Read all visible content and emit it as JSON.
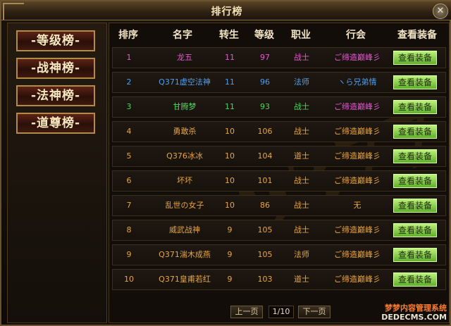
{
  "window": {
    "title": "排行榜",
    "close_glyph": "✕"
  },
  "tabs": [
    {
      "label": "-等级榜-",
      "active": true
    },
    {
      "label": "-战神榜-",
      "active": false
    },
    {
      "label": "-法神榜-",
      "active": false
    },
    {
      "label": "-道尊榜-",
      "active": false
    }
  ],
  "table": {
    "headers": [
      "排序",
      "名字",
      "转生",
      "等级",
      "职业",
      "行会",
      "查看装备"
    ],
    "rows": [
      {
        "rank": "1",
        "name": "龙五",
        "rebirth": "11",
        "level": "97",
        "class": "战士",
        "guild": "ご缔造巅峰彡",
        "button": "查看装备",
        "color": "#e25bd0",
        "guild_color": "#e25bd0"
      },
      {
        "rank": "2",
        "name": "Q371虚空法神",
        "rebirth": "11",
        "level": "96",
        "class": "法师",
        "guild": "ヽら兄弟情",
        "button": "查看装备",
        "color": "#4f9ef0",
        "guild_color": "#4f9ef0"
      },
      {
        "rank": "3",
        "name": "甘腾梦",
        "rebirth": "11",
        "level": "93",
        "class": "战士",
        "guild": "ご缔造巅峰彡",
        "button": "查看装备",
        "color": "#4fd65a",
        "guild_color": "#e25bd0"
      },
      {
        "rank": "4",
        "name": "勇敢杀",
        "rebirth": "10",
        "level": "106",
        "class": "战士",
        "guild": "ご缔造巅峰彡",
        "button": "查看装备",
        "color": "#e8a640",
        "guild_color": "#e8a640"
      },
      {
        "rank": "5",
        "name": "Q376冰冰",
        "rebirth": "10",
        "level": "104",
        "class": "道士",
        "guild": "ご缔造巅峰彡",
        "button": "查看装备",
        "color": "#e8a640",
        "guild_color": "#e8a640"
      },
      {
        "rank": "6",
        "name": "坏坏",
        "rebirth": "10",
        "level": "101",
        "class": "战士",
        "guild": "ご缔造巅峰彡",
        "button": "查看装备",
        "color": "#e8a640",
        "guild_color": "#e8a640"
      },
      {
        "rank": "7",
        "name": "乱世の女子",
        "rebirth": "10",
        "level": "86",
        "class": "战士",
        "guild": "无",
        "button": "查看装备",
        "color": "#e8a640",
        "guild_color": "#e8a640"
      },
      {
        "rank": "8",
        "name": "威武战神",
        "rebirth": "9",
        "level": "105",
        "class": "战士",
        "guild": "ご缔造巅峰彡",
        "button": "查看装备",
        "color": "#e8a640",
        "guild_color": "#e8a640"
      },
      {
        "rank": "9",
        "name": "Q371湍木成燕",
        "rebirth": "9",
        "level": "105",
        "class": "法师",
        "guild": "ご缔造巅峰彡",
        "button": "查看装备",
        "color": "#e8a640",
        "guild_color": "#e8a640"
      },
      {
        "rank": "10",
        "name": "Q371皇甫若红",
        "rebirth": "9",
        "level": "103",
        "class": "道士",
        "guild": "ご缔造巅峰彡",
        "button": "查看装备",
        "color": "#e8a640",
        "guild_color": "#e8a640"
      }
    ]
  },
  "pager": {
    "prev": "上一页",
    "page": "1/10",
    "next": "下一页"
  },
  "watermark": "9377",
  "site": {
    "line1": "梦梦内容管理系统",
    "line2": "DEDECMS.COM"
  }
}
